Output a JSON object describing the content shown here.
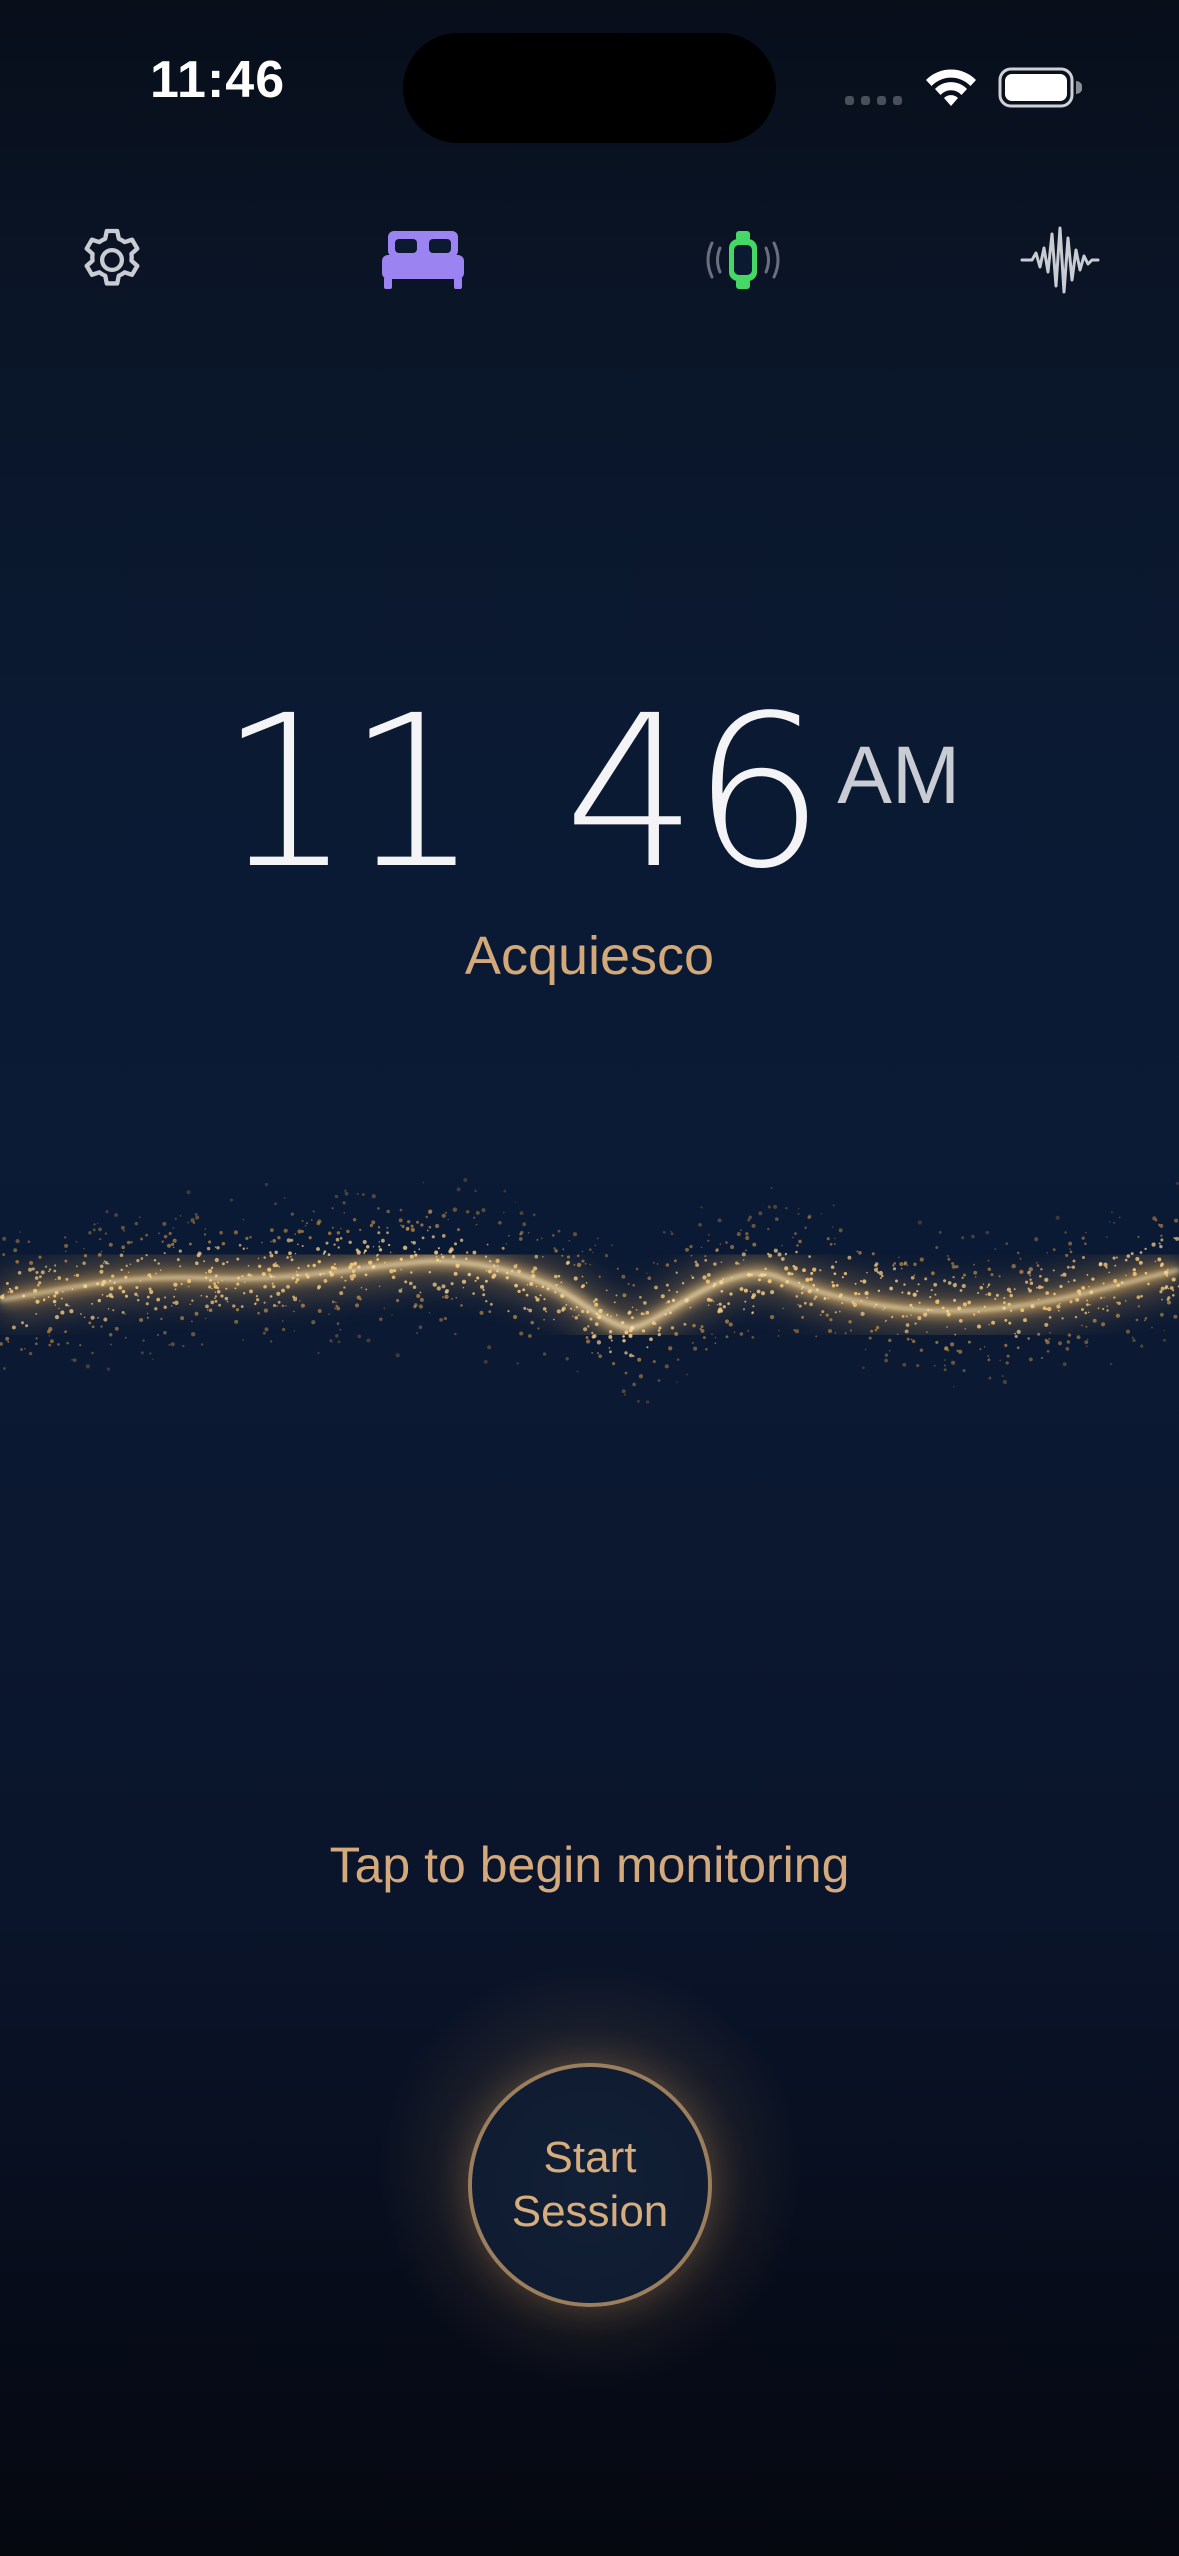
{
  "status_bar": {
    "time": "11:46"
  },
  "toolbar": {
    "items": [
      {
        "name": "settings",
        "icon": "gear-icon"
      },
      {
        "name": "sleep",
        "icon": "bed-icon",
        "active": true,
        "color": "#9b83f2"
      },
      {
        "name": "watch",
        "icon": "apple-watch-icon",
        "color": "#46d866"
      },
      {
        "name": "sounds",
        "icon": "waveform-icon"
      }
    ]
  },
  "clock": {
    "hour": "11",
    "minute": "46",
    "ampm": "AM"
  },
  "app_name": "Acquiesco",
  "prompt": "Tap to begin monitoring",
  "start_button": {
    "label": "Start\nSession"
  },
  "colors": {
    "accent_gold": "#d6aa7b",
    "active_purple": "#9b83f2",
    "watch_green": "#46d866"
  }
}
